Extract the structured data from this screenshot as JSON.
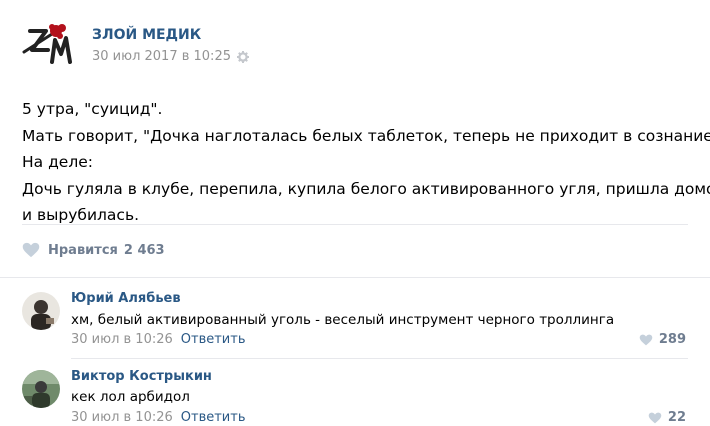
{
  "post": {
    "author": "ЗЛОЙ МЕДИК",
    "date": "30 июл 2017 в 10:25",
    "lines": [
      "5 утра, \"суицид\".",
      "Мать говорит, \"Дочка наглоталась белых таблеток, теперь не приходит в сознание\".",
      "На деле:",
      "Дочь гуляла в клубе, перепила, купила белого активированного угля, пришла домой",
      "и вырубилась."
    ],
    "likes_label": "Нравится",
    "likes_count": "2 463",
    "icons": {
      "logo": "zm-logo-icon",
      "settings": "gear-icon",
      "like": "heart-icon"
    }
  },
  "comments": [
    {
      "name": "Юрий Алябьев",
      "text": "хм, белый активированный уголь - веселый инструмент черного троллинга",
      "date": "30 июл в 10:26",
      "reply": "Ответить",
      "likes": "289"
    },
    {
      "name": "Виктор Кострыкин",
      "text": "кек лол арбидол",
      "date": "30 июл в 10:26",
      "reply": "Ответить",
      "likes": "22"
    }
  ],
  "colors": {
    "link": "#2a5885",
    "muted": "#939393",
    "like": "#6f7d90",
    "divider": "#e7e8ec",
    "logo_red": "#b3111c"
  }
}
